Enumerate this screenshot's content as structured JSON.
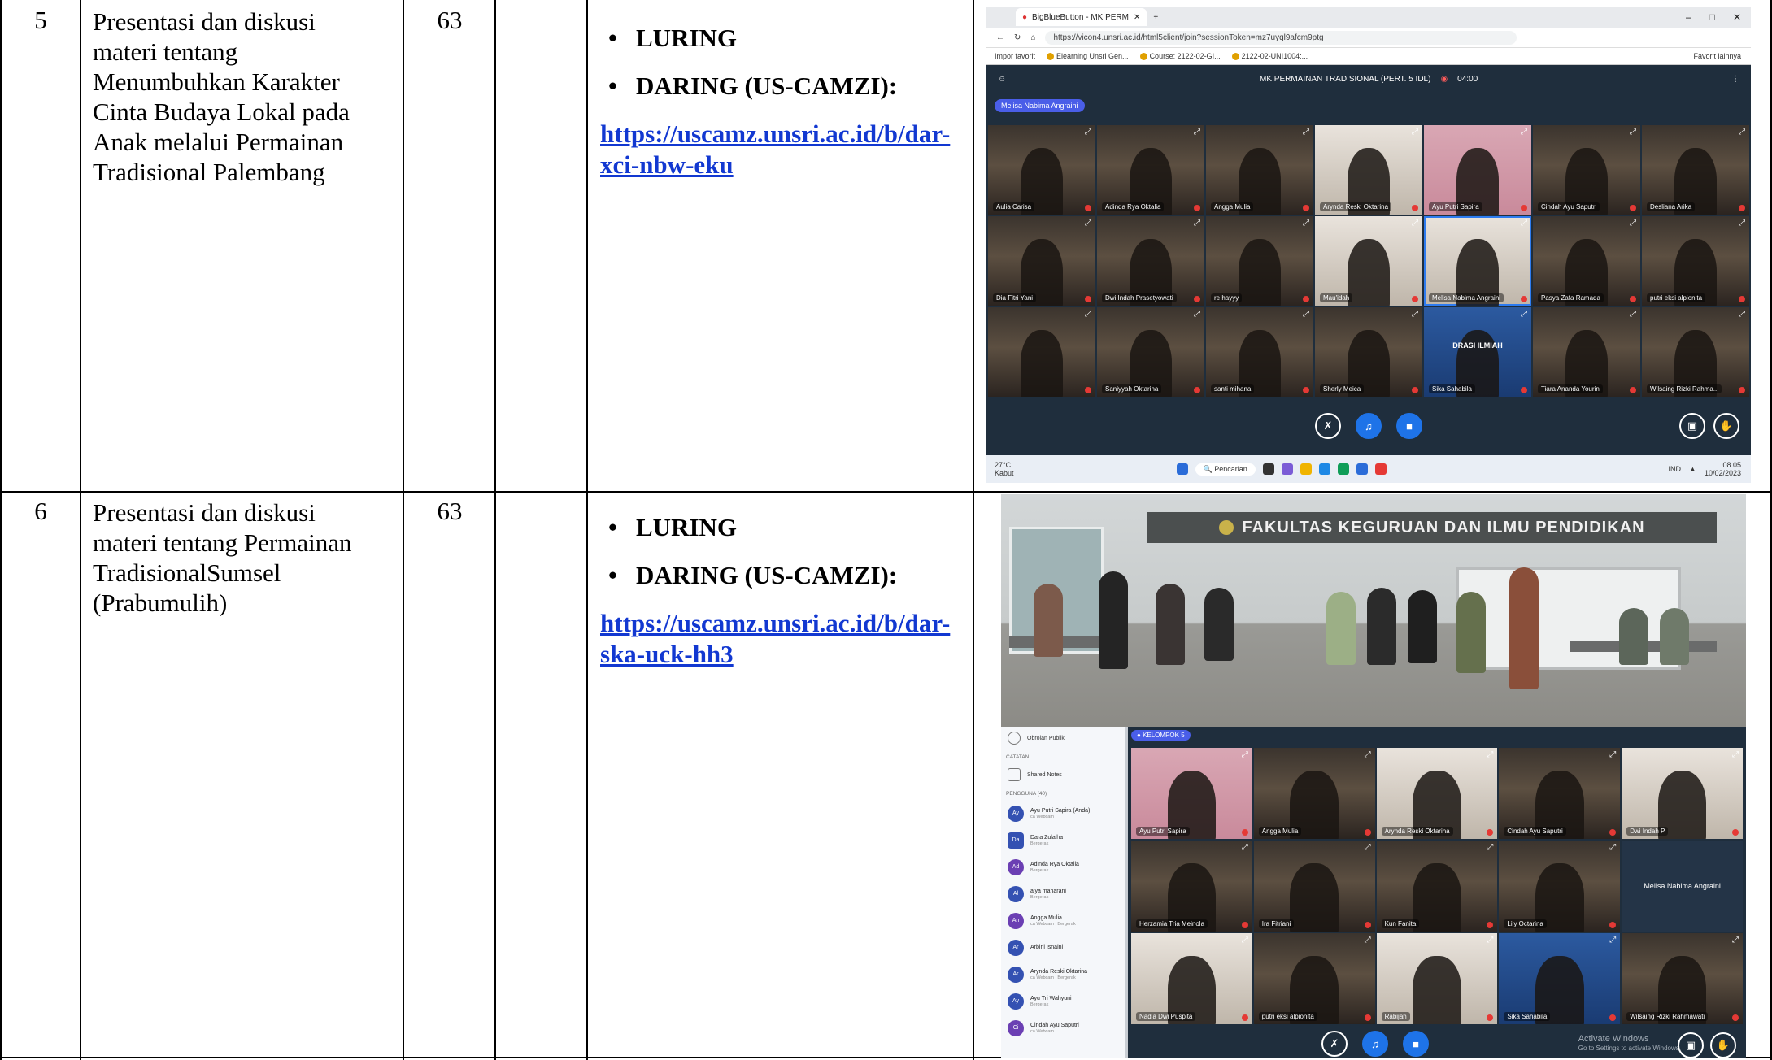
{
  "rows": [
    {
      "number": "5",
      "description_lines": [
        "Presentasi dan diskusi",
        "materi tentang",
        "Menumbuhkan Karakter",
        "Cinta Budaya Lokal pada",
        "Anak melalui Permainan",
        "Tradisional Palembang"
      ],
      "count": "63",
      "modes": [
        "LURING",
        "DARING (US-CAMZI):"
      ],
      "link_lines": [
        "https://uscamz.unsri.ac.id/b/dar-",
        "xci-nbw-eku"
      ]
    },
    {
      "number": "6",
      "description_lines": [
        "Presentasi dan diskusi",
        "materi tentang Permainan",
        "TradisionalSumsel",
        "(Prabumulih)"
      ],
      "count": "63",
      "modes": [
        "LURING",
        "DARING (US-CAMZI):"
      ],
      "link_lines": [
        "https://uscamz.unsri.ac.id/b/dar-",
        "ska-uck-hh3"
      ]
    }
  ],
  "screenshot1": {
    "browser_tab": "BigBlueButton - MK PERM",
    "url": "https://vicon4.unsri.ac.id/html5client/join?sessionToken=mz7uyql9afcm9ptg",
    "favorites": [
      "Impor favorit",
      "Elearning Unsri Gen...",
      "Course: 2122-02-GI...",
      "2122-02-UNI1004:..."
    ],
    "favorites_other": "Favorit lainnya",
    "meeting_title": "MK PERMAINAN TRADISIONAL (PERT. 5 IDL)",
    "timer": "04:00",
    "presenter": "Melisa Nabima Angraini",
    "participants": [
      "Aulia Carisa",
      "Adinda Rya Oktalia",
      "Angga Mulia",
      "Arynda Reski Oktarina",
      "Ayu Putri Sapira",
      "Cindah Ayu Saputri",
      "Desliana Arika",
      "Dia Fitri Yani",
      "Dwi Indah Prasetyowati",
      "re hayyy",
      "Mau'idah",
      "Melisa Nabima Angraini",
      "Pasya Zafa Ramada",
      "putri eksi alpionita",
      "",
      "Saniyyah Oktarina",
      "santi mihana",
      "Sherly Meica",
      "Sika Sahabila",
      "Tiara Ananda Yourin",
      "Wilsaing Rizki Rahma..."
    ],
    "tile_styles": [
      "",
      "",
      "",
      "light",
      "pink",
      "",
      "",
      "",
      "",
      "",
      "light",
      "light",
      "",
      "",
      "",
      "",
      "",
      "",
      "blue",
      "",
      ""
    ],
    "tile_inner_text": "DRASI ILMIAH",
    "active_tile": "Melisa Nabima Angraini",
    "taskbar": {
      "temperature": "27°C",
      "weather": "Kabut",
      "search": "Pencarian",
      "lang": "IND",
      "time": "08.05",
      "date": "10/02/2023"
    }
  },
  "photo": {
    "sign": "FAKULTAS KEGURUAN DAN ILMU PENDIDIKAN"
  },
  "screenshot2": {
    "public_chat": "Obrolan Publik",
    "notes_header": "CATATAN",
    "shared_notes": "Shared Notes",
    "users_header": "PENGGUNA (40)",
    "users": [
      {
        "initials": "Ay",
        "name": "Ayu Putri Sapira (Anda)",
        "sub": "ca Webcam",
        "style": ""
      },
      {
        "initials": "Da",
        "name": "Dara Zulaiha",
        "sub": "Bergerak",
        "style": "sq"
      },
      {
        "initials": "Ad",
        "name": "Adinda Rya Oktalia",
        "sub": "Bergerak",
        "style": "pur"
      },
      {
        "initials": "Al",
        "name": "alya maharani",
        "sub": "Bergerak",
        "style": ""
      },
      {
        "initials": "An",
        "name": "Angga Mulia",
        "sub": "ca Webcam | Bergerak",
        "style": "pur"
      },
      {
        "initials": "Ar",
        "name": "Arbini Isnaini",
        "sub": "",
        "style": ""
      },
      {
        "initials": "Ar",
        "name": "Arynda Reski Oktarina",
        "sub": "ca Webcam | Bergerak",
        "style": ""
      },
      {
        "initials": "Ay",
        "name": "Ayu Tri Wahyuni",
        "sub": "Bergerak",
        "style": ""
      },
      {
        "initials": "Ci",
        "name": "Cindah Ayu Saputri",
        "sub": "ca Webcam",
        "style": "pur"
      }
    ],
    "group": "KELOMPOK 5",
    "participants": [
      "Ayu Putri Sapira",
      "Angga Mulia",
      "Arynda Reski Oktarina",
      "Cindah Ayu Saputri",
      "Dwi Indah P",
      "Herzamia Tria Meinola",
      "Ira Fitriani",
      "Kun Fanita",
      "Lily Octarina",
      "Melisa Nabima Angraini",
      "Nadia Dwi Puspita",
      "putri eksi alpionita",
      "Rabijah",
      "Sika Sahabila",
      "Wilsaing Rizki Rahmawati"
    ],
    "tile_styles": [
      "pink",
      "",
      "light",
      "",
      "light",
      "",
      "",
      "",
      "",
      "name",
      "light",
      "",
      "light",
      "blue",
      ""
    ],
    "activate_title": "Activate Windows",
    "activate_sub": "Go to Settings to activate Windows."
  }
}
